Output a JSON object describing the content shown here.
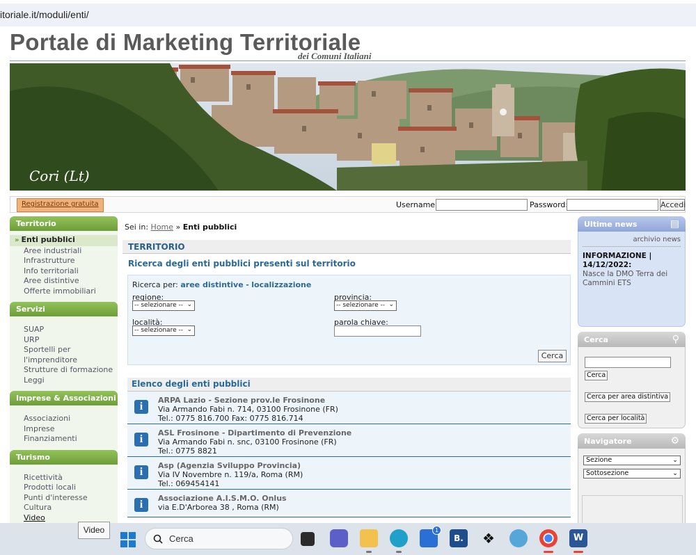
{
  "browser": {
    "url": "itoriale.it/moduli/enti/"
  },
  "site": {
    "title": "Portale di Marketing Territoriale",
    "subtitle": "dei Comuni Italiani",
    "banner_caption": "Cori (Lt)"
  },
  "login": {
    "register": "Registrazione gratuita",
    "username_label": "Username:",
    "password_label": "Password:",
    "submit": "Accedi"
  },
  "sidebar": {
    "territorio": {
      "title": "Territorio",
      "items": [
        "Enti pubblici",
        "Aree industriali",
        "Infrastrutture",
        "Info territoriali",
        "Aree distintive",
        "Offerte immobiliari"
      ]
    },
    "servizi": {
      "title": "Servizi",
      "items": [
        "SUAP",
        "URP",
        "Sportelli per",
        "l'imprenditore",
        "Strutture di formazione",
        "Leggi"
      ]
    },
    "imprese": {
      "title": "Imprese & Associazioni",
      "items": [
        "Associazioni",
        "Imprese",
        "Finanziamenti"
      ]
    },
    "turismo": {
      "title": "Turismo",
      "items": [
        "Ricettività",
        "Prodotti locali",
        "Punti d'interesse",
        "Cultura",
        "Video"
      ]
    }
  },
  "main": {
    "crumb_prefix": "Sei in:",
    "crumb_home": "Home",
    "crumb_sep": "»",
    "crumb_current": "Enti pubblici",
    "band": "TERRITORIO",
    "heading": "Ricerca degli enti pubblici presenti sul territorio",
    "search": {
      "by_label": "Ricerca per:",
      "by_aree": "aree distintive",
      "by_dash": "-",
      "by_loc": "localizzazione",
      "regione_label": "regione:",
      "provincia_label": "provincia:",
      "localita_label": "località:",
      "keyword_label": "parola chiave:",
      "select_value": "-- selezionare --",
      "button": "Cerca"
    },
    "list_title": "Elenco degli enti pubblici",
    "entities": [
      {
        "name": "ARPA Lazio - Sezione prov.le Frosinone",
        "address": "Via Armando Fabi n. 714, 03100 Frosinone (FR)",
        "tel": "Tel.: 0775 816.700 Fax: 0775 816.714"
      },
      {
        "name": "ASL Frosinone - Dipartimento di Prevenzione",
        "address": "Via Armando Fabi n. snc, 03100 Frosinone (FR)",
        "tel": "Tel.: 0775 8821"
      },
      {
        "name": "Asp (Agenzia Sviluppo Provincia)",
        "address": "Via IV Novembre n. 119/a, Roma (RM)",
        "tel": "Tel.: 069454141"
      },
      {
        "name": "Associazione A.I.S.M.O. Onlus",
        "address": "via E.D'Arborea 38 , Roma (RM)",
        "tel": ""
      }
    ]
  },
  "right": {
    "news": {
      "title": "Ultime news",
      "archive": "archivio news",
      "item_title": "INFORMAZIONE | 14/12/2022:",
      "item_text": "Nasce la DMO Terra dei Cammini ETS"
    },
    "cerca": {
      "title": "Cerca",
      "button": "Cerca",
      "by_area": "Cerca per area distintiva",
      "by_loc": "Cerca per località"
    },
    "nav": {
      "title": "Navigatore",
      "sezione": "Sezione",
      "sottosezione": "Sottosezione"
    }
  },
  "tooltip": "Video",
  "taskbar": {
    "search": "Cerca",
    "store_badge": "1",
    "bluebeam": "B."
  }
}
